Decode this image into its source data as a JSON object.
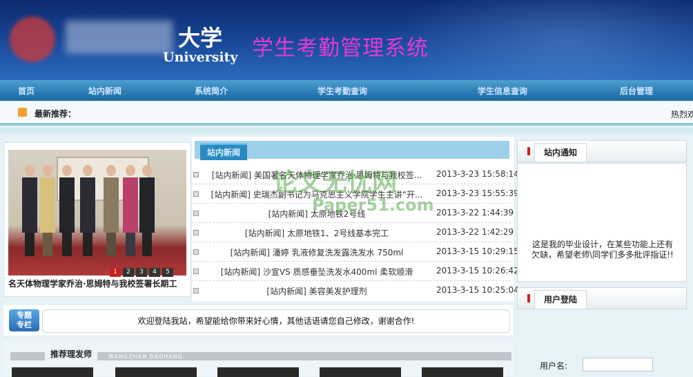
{
  "header": {
    "university_cn": "大学",
    "university_en": "University",
    "system_title": "学生考勤管理系统"
  },
  "nav": [
    {
      "label": "首页"
    },
    {
      "label": "站内新闻"
    },
    {
      "label": "系统简介"
    },
    {
      "label": "学生考勤查询"
    },
    {
      "label": "学生信息查询"
    },
    {
      "label": "后台管理"
    }
  ],
  "ticker": {
    "label": "最新推荐：",
    "hot": "热烈欢"
  },
  "slideshow": {
    "pages": [
      "1",
      "2",
      "3",
      "4",
      "5"
    ],
    "active_page": "1",
    "caption": "名天体物理学家乔治·思姆特与我校签署长期工"
  },
  "news": {
    "tab_label": "站内新闻",
    "items": [
      {
        "title": "[站内新闻] 美国著名天体物理学家乔治·思姆特与我校签...",
        "date": "2013-3-23 15:58:14"
      },
      {
        "title": "[站内新闻] 史瑞杰副书记为马克思主义学院学生主讲“开...",
        "date": "2013-3-23 15:55:39"
      },
      {
        "title": "[站内新闻] 太原地铁2号线",
        "date": "2013-3-22 1:44:39"
      },
      {
        "title": "[站内新闻] 太原地铁1、2号线基本完工",
        "date": "2013-3-22 1:42:29"
      },
      {
        "title": "[站内新闻] 潘婷 乳液修复洗发露洗发水 750ml",
        "date": "2013-3-15 10:29:15"
      },
      {
        "title": "[站内新闻] 沙宣VS 质感垂坠洗发水400ml 柔软顺滑",
        "date": "2013-3-15 10:26:42"
      },
      {
        "title": "[站内新闻] 美容美发护理剂",
        "date": "2013-3-15 10:25:04"
      }
    ],
    "watermark_cn": "论文无忧网",
    "watermark_en": "Paper51.com"
  },
  "notice": {
    "tab_label": "站内通知",
    "text": "这是我的毕业设计，在某些功能上还有欠缺，希望老师\\同学们多多批评指证!!"
  },
  "login": {
    "tab_label": "用户登陆",
    "username_label": "用户名:"
  },
  "welcome": {
    "badge_line1": "专题",
    "badge_line2": "专栏",
    "message": "欢迎登陆我站，希望能给你带来好心情，其他话语请您自己修改，谢谢合作!"
  },
  "recommend": {
    "label": "推荐理发师",
    "watermark": "WANGZHAN DAOHANG"
  }
}
